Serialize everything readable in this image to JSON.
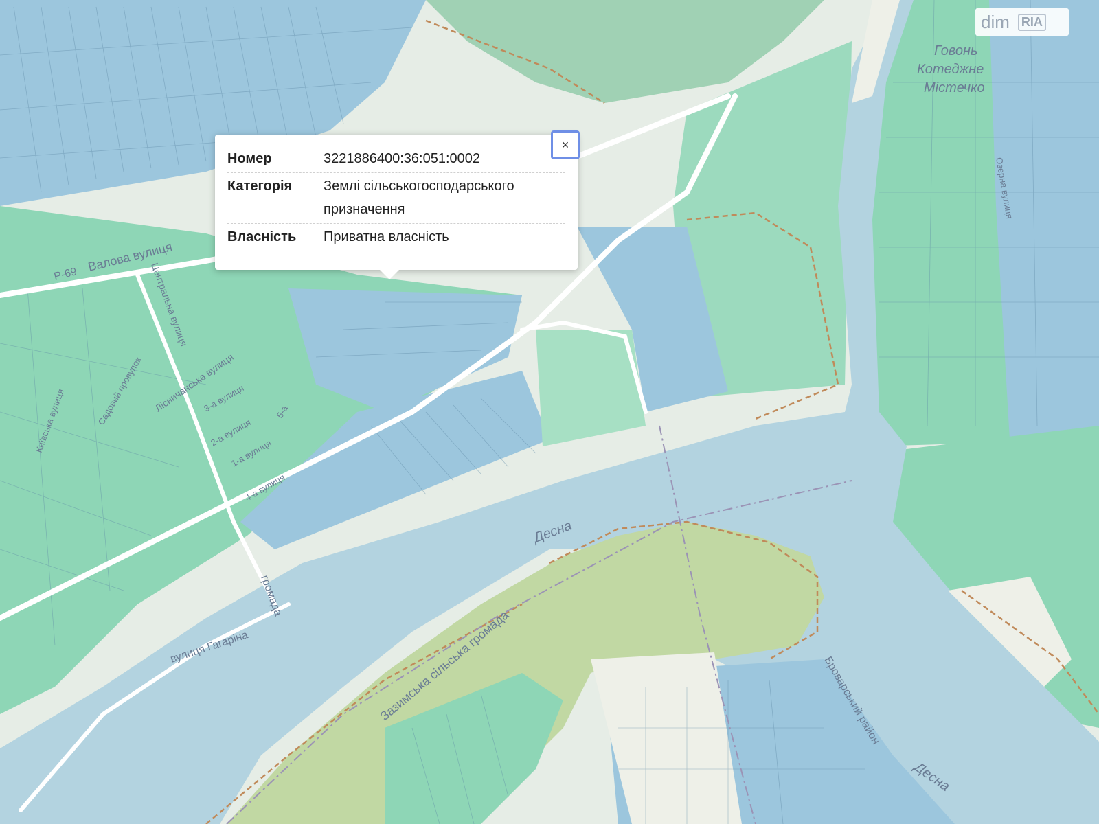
{
  "popup": {
    "number_label": "Номер",
    "number_value": "3221886400:36:051:0002",
    "category_label": "Категорія",
    "category_value_line1": "Землі сільськогосподарського",
    "category_value_line2": "призначення",
    "ownership_label": "Власність",
    "ownership_value": "Приватна власність",
    "close_label": "×"
  },
  "map_labels": {
    "river_1": "Десна",
    "river_2": "Десна",
    "street_valova": "Валова вулиця",
    "road_p69": "Р-69",
    "street_gagarina": "вулиця Гагаріна",
    "street_tsentralna": "Центральна вулиця",
    "street_lisnychanska": "Лісничанська вулиця",
    "street_3a": "3-а вулиця",
    "street_2a": "2-а вулиця",
    "street_4a": "4-а вулиця",
    "street_1a": "1-а вулиця",
    "street_5a": "5-а",
    "street_garden": "Садовий провулок",
    "street_kyivska": "Київська вулиця",
    "community_zazymska": "Зазимська сільська громада",
    "community_short": "громада",
    "district_brovarskyi": "Броварський район",
    "place_govon": "Говонь",
    "place_kotedzhne": "Котеджне",
    "place_mistechko": "Містечко",
    "street_ozerna": "Озерна вулиця"
  },
  "watermark": {
    "text_dim": "dim",
    "text_ria": "RIA"
  },
  "colors": {
    "water": "#b3d3e0",
    "parcel_green": "#8ed6b6",
    "parcel_blue": "#9cc6dd",
    "parcel_dark_blue": "#6ba3c9",
    "forest": "#c1d8a3",
    "land": "#e8efe8",
    "road": "#ffffff",
    "boundary": "#c08a5a"
  }
}
